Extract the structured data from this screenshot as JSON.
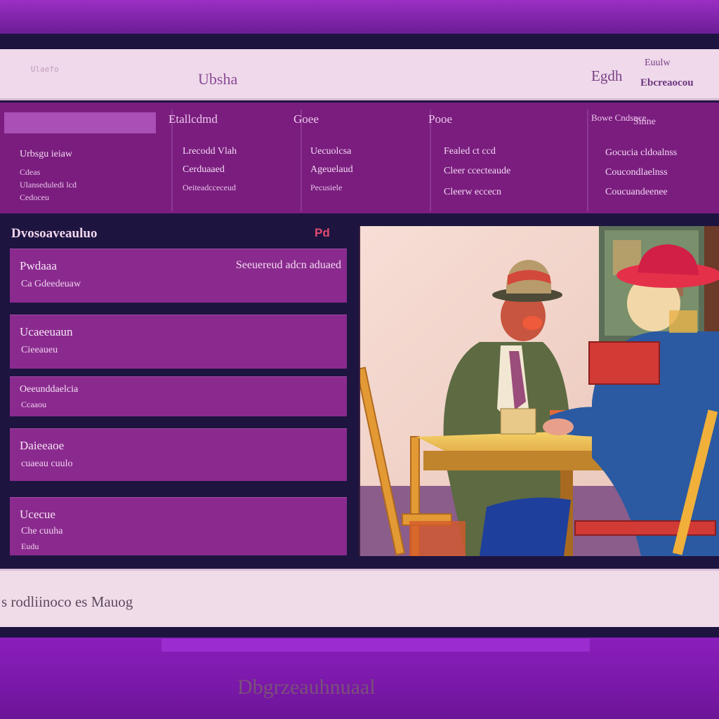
{
  "header": {
    "logo_text": "Ulaefo",
    "brand": "Ubsha",
    "right_a": "Egdh",
    "right_b": "Euulw",
    "right_c": "Ebcreaocou"
  },
  "nav": {
    "columns": [
      {
        "title": "Etallcdmd",
        "links": [
          "Lrecodd Vlah",
          "Cerduaaed",
          "Oeiteadcceceud"
        ]
      },
      {
        "title": "Goee",
        "links": [
          "Uecuolcsa",
          "Ageuelaud",
          "Pecusiele"
        ]
      },
      {
        "title": "Pooe",
        "links": [
          "Fealed ct ccd",
          "Cleer ccecteaude",
          "Cleerw eccecn"
        ]
      },
      {
        "title": "Sinne",
        "links": [
          "Gocucia cldoalnss",
          "Coucondlaelnss",
          "Coucuandeenee"
        ]
      },
      {
        "title": "Bowe Cndsnce",
        "links": []
      }
    ],
    "left_links": [
      "Urbsgu ieiaw",
      "Cdeas",
      "Ulanseduledi lcd",
      "Cedoceu"
    ]
  },
  "list": {
    "title": "Dvosoaveauluo",
    "badge": "Pd",
    "cards": [
      {
        "title": "Pwdaaa",
        "subtitle": "Ca Gdeedeuaw",
        "right": "Seeuereud adcn aduaed"
      },
      {
        "title": "Ucaeeuaun",
        "subtitle": "Cieeaueu",
        "right": ""
      },
      {
        "title": "Oeeunddaelcia",
        "subtitle": "Ccaaou",
        "right": ""
      },
      {
        "title": "Daieeaoe",
        "subtitle": "cuaeau cuulo",
        "right": ""
      },
      {
        "title": "Ucecue",
        "subtitle": "Che cuuha",
        "subtitle2": "Eudu",
        "right": ""
      }
    ]
  },
  "footer": {
    "text": "s rodliinoco es Mauog"
  },
  "bottom": {
    "text": "Dbgrzeauhnuaal"
  },
  "colors": {
    "accent": "#8a2a8e",
    "band": "#7a1d7e",
    "frame": "#9a2fc4"
  }
}
